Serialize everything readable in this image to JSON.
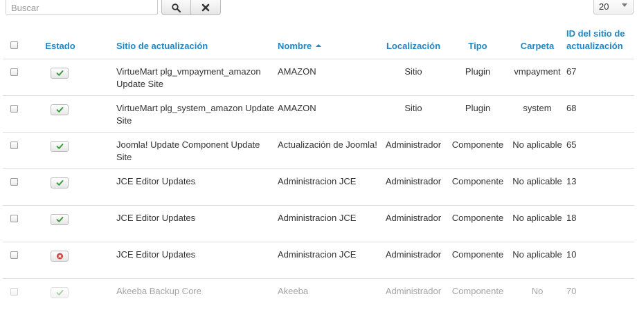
{
  "toolbar": {
    "search_placeholder": "Buscar",
    "search_button_icon": "search-icon",
    "clear_button_icon": "close-icon",
    "limit_value": "20"
  },
  "table": {
    "headers": {
      "estado": "Estado",
      "sitio": "Sitio de actualización",
      "nombre": "Nombre",
      "localizacion": "Localización",
      "tipo": "Tipo",
      "carpeta": "Carpeta",
      "id": "ID del sitio de actualización"
    },
    "sort_column": "nombre",
    "sort_direction": "ascending",
    "rows": [
      {
        "enabled": true,
        "site": "VirtueMart plg_vmpayment_amazon Update Site",
        "name": "AMAZON",
        "location": "Sitio",
        "type": "Plugin",
        "folder": "vmpayment",
        "id": "67"
      },
      {
        "enabled": true,
        "site": "VirtueMart plg_system_amazon Update Site",
        "name": "AMAZON",
        "location": "Sitio",
        "type": "Plugin",
        "folder": "system",
        "id": "68"
      },
      {
        "enabled": true,
        "site": "Joomla! Update Component Update Site",
        "name": "Actualización de Joomla!",
        "location": "Administrador",
        "type": "Componente",
        "folder": "No aplicable",
        "id": "65"
      },
      {
        "enabled": true,
        "site": "JCE Editor Updates",
        "name": "Administracion JCE",
        "location": "Administrador",
        "type": "Componente",
        "folder": "No aplicable",
        "id": "13"
      },
      {
        "enabled": true,
        "site": "JCE Editor Updates",
        "name": "Administracion JCE",
        "location": "Administrador",
        "type": "Componente",
        "folder": "No aplicable",
        "id": "18"
      },
      {
        "enabled": false,
        "site": "JCE Editor Updates",
        "name": "Administracion JCE",
        "location": "Administrador",
        "type": "Componente",
        "folder": "No aplicable",
        "id": "10"
      },
      {
        "enabled": true,
        "site": "Akeeba Backup Core",
        "name": "Akeeba",
        "location": "Administrador",
        "type": "Componente",
        "folder": "No",
        "id": "70"
      }
    ]
  },
  "colors": {
    "header_link": "#1f86c3",
    "enabled_check": "#3a9a3a",
    "disabled_x": "#d43a3a"
  }
}
